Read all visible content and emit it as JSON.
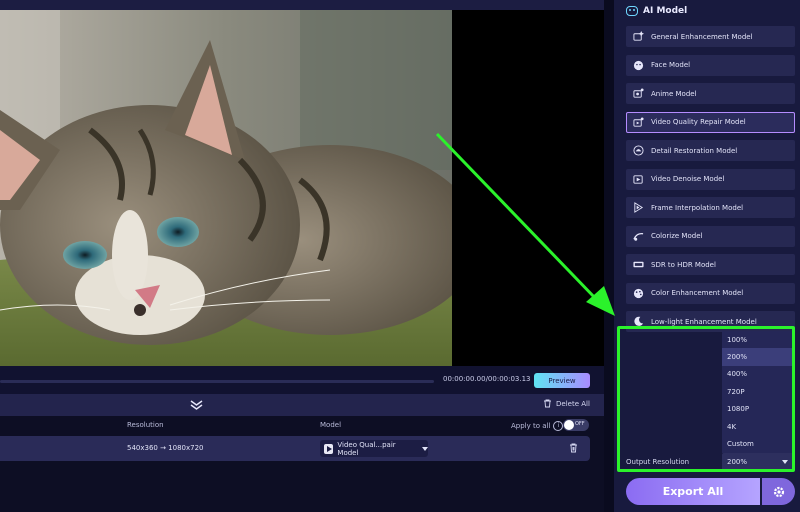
{
  "player": {
    "timecode": "00:00:00.00/00:00:03.13",
    "preview_label": "Preview"
  },
  "toolbar": {
    "delete_all_label": "Delete All"
  },
  "table": {
    "headers": {
      "resolution": "Resolution",
      "model": "Model",
      "apply_to_all": "Apply to all",
      "toggle_state": "OFF"
    },
    "rows": [
      {
        "resolution": "540x360 → 1080x720",
        "model": "Video Qual...pair Model"
      }
    ]
  },
  "panel": {
    "title": "AI Model",
    "models": [
      {
        "label": "General Enhancement Model",
        "icon": "sparkle-image-icon",
        "active": false
      },
      {
        "label": "Face Model",
        "icon": "face-icon",
        "active": false
      },
      {
        "label": "Anime Model",
        "icon": "anime-icon",
        "active": false
      },
      {
        "label": "Video Quality Repair Model",
        "icon": "video-repair-icon",
        "active": true
      },
      {
        "label": "Detail Restoration Model",
        "icon": "detail-icon",
        "active": false
      },
      {
        "label": "Video Denoise Model",
        "icon": "denoise-icon",
        "active": false
      },
      {
        "label": "Frame Interpolation Model",
        "icon": "frames-icon",
        "active": false
      },
      {
        "label": "Colorize Model",
        "icon": "colorize-icon",
        "active": false
      },
      {
        "label": "SDR to HDR Model",
        "icon": "hdr-icon",
        "active": false
      },
      {
        "label": "Color Enhancement Model",
        "icon": "palette-icon",
        "active": false
      },
      {
        "label": "Low-light Enhancement Model",
        "icon": "moon-icon",
        "active": false
      }
    ],
    "output_resolution_label": "Output Resolution",
    "output_resolution_value": "200%",
    "resolution_options": [
      "100%",
      "200%",
      "400%",
      "720P",
      "1080P",
      "4K",
      "Custom"
    ],
    "export_label": "Export All"
  },
  "colors": {
    "accent": "#a98bff",
    "highlight": "#2bf22b",
    "panel_bg": "#181a3e"
  }
}
